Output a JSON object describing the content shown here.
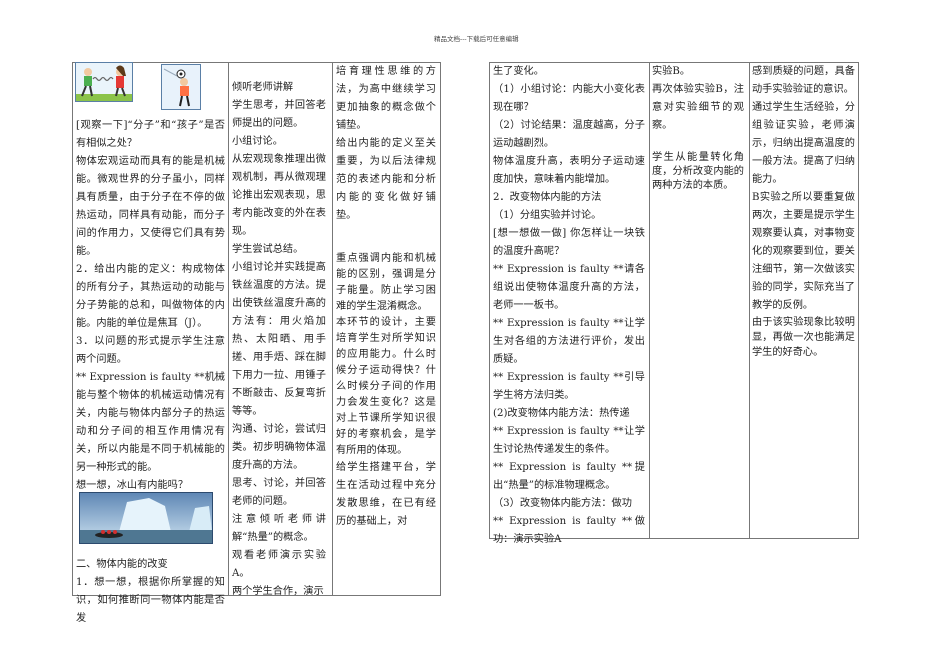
{
  "header": {
    "text": "精品文档---下载后可任意编辑"
  },
  "left_table": {
    "col1": [
      "[观察一下]“分子”和“孩子”是否有相似之处？",
      "物体宏观运动而具有的能是机械能。微观世界的分子虽小，同样具有质量，由于分子在不停的做热运动，同样具有动能，而分子间的作用力，又使得它们具有势能。",
      "2．给出内能的定义：构成物体的所有分子，其热运动的动能与分子势能的总和，叫做物体的内能。内能的单位是焦耳（J）。",
      "3．以问题的形式提示学生注意两个问题。",
      "** Expression is faulty **机械能与整个物体的机械运动情况有关，内能与物体内部分子的热运动和分子间的相互作用情况有关，所以内能是不同于机械能的另一种形式的能。",
      "想一想，冰山有内能吗？",
      "二、物体内能的改变",
      "1．想一想，根据你所掌握的知识，如何推断同一物体内能是否发"
    ],
    "col2": [
      "倾听老师讲解",
      "学生思考，并回答老师提出的问题。",
      "小组讨论。",
      "从宏观现象推理出微观机制，再从微观理论推出宏观表现，思考内能改变的外在表现。",
      "学生尝试总结。",
      "小组讨论并实践提高铁丝温度的方法。提出使铁丝温度升高的方法有：用火焰加热、太阳晒、用手搓、用手焐、踩在脚下用力一拉、用锤子不断敲击、反复弯折等等。",
      "沟通、讨论，尝试归类。初步明确物体温度升高的方法。",
      "思考、讨论，并回答老师的问题。",
      "注意倾听老师讲解“热量”的概念。",
      "观看老师演示实验A。",
      "两个学生合作，演示"
    ],
    "col3": [
      "培育理性思维的方法，为高中继续学习更加抽象的概念做个铺垫。",
      "给出内能的定义至关重要，为以后法律规范的表述内能和分析内能的变化做好铺垫。",
      " 重点强调内能和机械能的区别，强调是分子能量。防止学习困难的学生混淆概念。",
      "本环节的设计，主要培育学生对所学知识的应用能力。什么时候分子运动得快？什么时候分子间的作用力会发生变化？这是对上节课所学知识很好的考察机会，是学有所用的体现。",
      "给学生搭建平台，学生在活动过程中充分发散思维，在已有经历的基础上，对"
    ]
  },
  "right_table": {
    "col1": [
      "生了变化。",
      "（1）小组讨论：内能大小变化表现在哪？",
      "（2）讨论结果：温度越高，分子运动越剧烈。",
      "物体温度升高，表明分子运动速度加快，意味着内能增加。",
      "2．改变物体内能的方法",
      "（1）分组实验并讨论。",
      "[想一想做一做] 你怎样让一块铁的温度升高呢？",
      "** Expression is faulty **请各组说出使物体温度升高的方法，老师一一板书。",
      "** Expression is faulty **让学生对各组的方法进行评价，发出质疑。",
      "** Expression is faulty **引导学生将方法归类。",
      "(2)改变物体内能方法：热传递",
      "** Expression is faulty **让学生讨论热传递发生的条件。",
      "** Expression is faulty **提出“热量”的标准物理概念。",
      "（3）改变物体内能方法：做功",
      "** Expression is faulty **做功：演示实验A"
    ],
    "col2": [
      "实验B。",
      "再次体验实验B，注意对实验细节的观察。",
      "学生从能量转化角度，分析改变内能的两种方法的本质。"
    ],
    "col3": [
      "感到质疑的问题，具备动手实验验证的意识。",
      "通过学生生活经验，分组验证实验，老师演示，归纳出提高温度的一般方法。提高了归纳能力。",
      "B实验之所以要重复做两次，主要是提示学生观察要认真，对事物变化的观察要到位，要关注细节，第一次做该实验的同学，实际充当了教学的反例。",
      "由于该实验现象比较明显，再做一次也能满足学生的好奇心。"
    ]
  }
}
